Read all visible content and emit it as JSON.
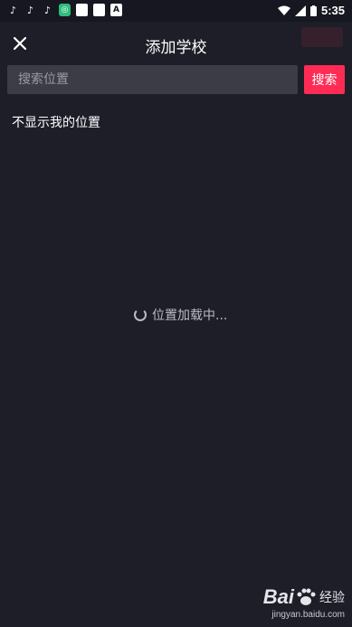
{
  "status_bar": {
    "time": "5:35",
    "left_icons": [
      "tiktok-icon",
      "tiktok-icon",
      "tiktok-icon",
      "app-icon",
      "square-icon",
      "square-icon",
      "a-icon"
    ],
    "a_label": "A"
  },
  "header": {
    "title": "添加学校"
  },
  "search": {
    "placeholder": "搜索位置",
    "button_label": "搜索"
  },
  "hide_location_label": "不显示我的位置",
  "loading_text": "位置加载中...",
  "watermark": {
    "brand_prefix": "Bai",
    "brand_suffix": "经验",
    "url": "jingyan.baidu.com"
  },
  "colors": {
    "background": "#1d1e28",
    "accent": "#fe2c55",
    "input_bg": "#3b3c45"
  }
}
